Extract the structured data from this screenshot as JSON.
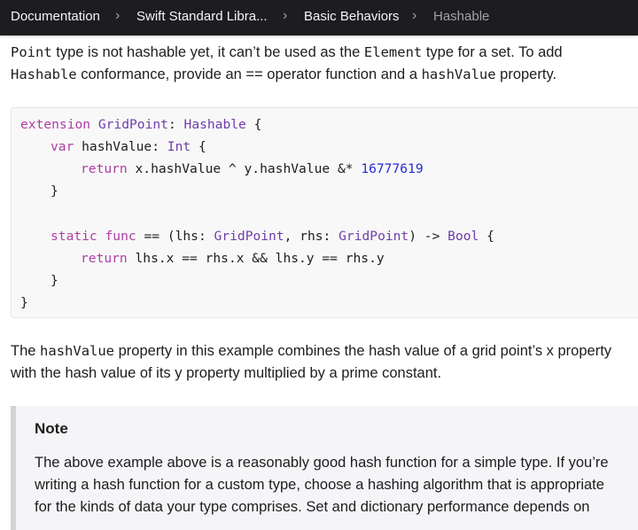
{
  "breadcrumb": {
    "items": [
      "Documentation",
      "Swift Standard Libra...",
      "Basic Behaviors",
      "Hashable"
    ]
  },
  "intro": {
    "line1": {
      "code1": "Point",
      "text1": " type is not hashable yet, it can’t be used as the ",
      "code2": "Element",
      "text2": " type for a set. To add"
    },
    "line2": {
      "code1": "Hashable",
      "text1": " conformance, provide an == operator function and a ",
      "code2": "hashValue",
      "text2": " property."
    }
  },
  "code": {
    "l1": {
      "kw": "extension",
      "type": "GridPoint",
      "colon": ": ",
      "proto": "Hashable",
      "rest": " {"
    },
    "l2": {
      "kw": "var",
      "name": " hashValue: ",
      "type": "Int",
      "rest": " {"
    },
    "l3": {
      "kw": "return",
      "expr": " x.hashValue ^ y.hashValue &* ",
      "num": "16777619"
    },
    "l4": {
      "text": "}"
    },
    "l5": {
      "kw1": "static",
      "kw2": "func",
      "sig1": " == (lhs: ",
      "t1": "GridPoint",
      "sig2": ", rhs: ",
      "t2": "GridPoint",
      "sig3": ") -> ",
      "t3": "Bool",
      "rest": " {"
    },
    "l6": {
      "kw": "return",
      "expr": " lhs.x == rhs.x && lhs.y == rhs.y"
    },
    "l7": {
      "text": "}"
    },
    "l8": {
      "text": "}"
    }
  },
  "explanation": {
    "line1": {
      "t1": "The ",
      "code1": "hashValue",
      "t2": " property in this example combines the hash value of a grid point’s x property"
    },
    "line2": "with the hash value of its y property multiplied by a prime constant."
  },
  "note": {
    "title": "Note",
    "lines": [
      "The above example above is a reasonably good hash function for a simple type. If you’re",
      "writing a hash function for a custom type, choose a hashing algorithm that is appropriate",
      "for the kinds of data your type comprises. Set and dictionary performance depends on"
    ]
  },
  "colors": {
    "nav_background": "#1d1d1f",
    "keyword": "#ad3da4",
    "type": "#703daa",
    "number": "#272ad8"
  }
}
